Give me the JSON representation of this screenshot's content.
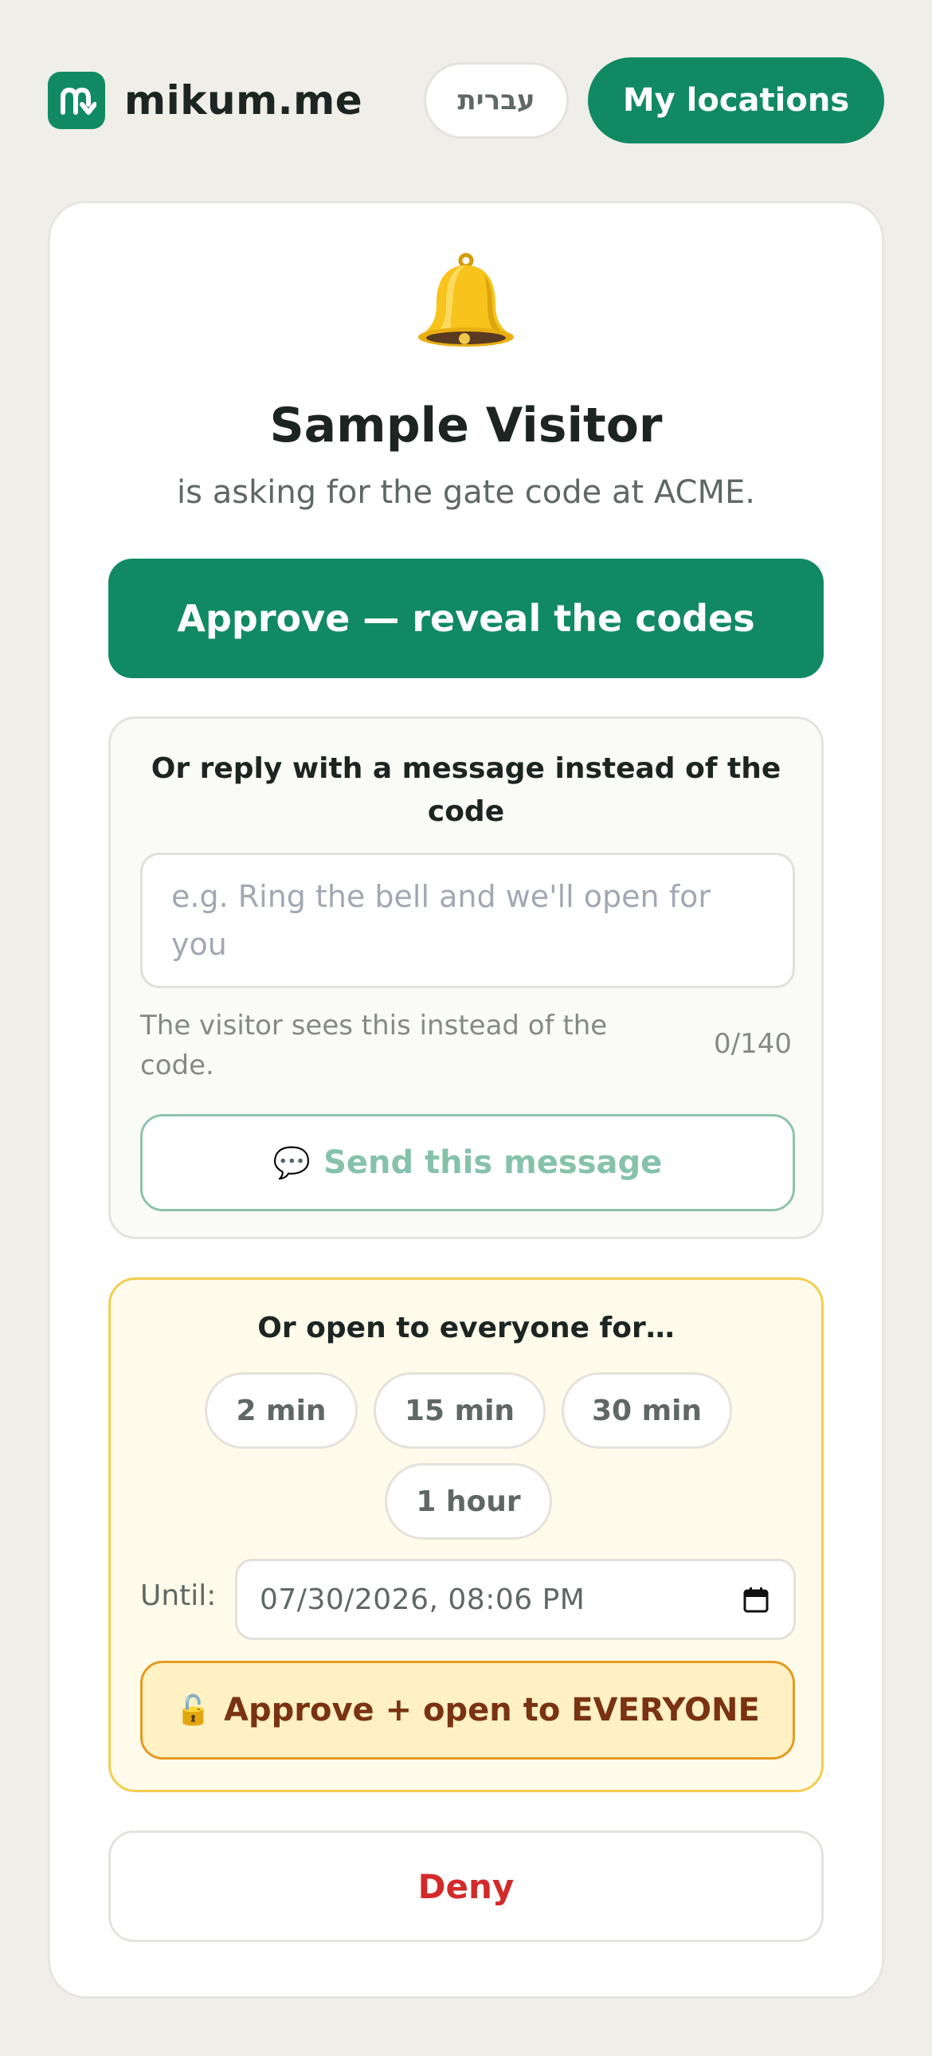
{
  "header": {
    "brand_name": "mikum.me",
    "language_label": "עברית",
    "my_locations_label": "My locations"
  },
  "request": {
    "visitor_name": "Sample Visitor",
    "subtitle": "is asking for the gate code at ACME.",
    "approve_label": "Approve — reveal the codes"
  },
  "reply": {
    "title": "Or reply with a message instead of the code",
    "input_value": "",
    "input_placeholder": "e.g. Ring the bell and we'll open for you",
    "hint": "The visitor sees this instead of the code.",
    "counter": "0/140",
    "send_label": "Send this message",
    "send_icon": "speech-bubble-icon"
  },
  "open_to_everyone": {
    "title": "Or open to everyone for…",
    "durations": [
      "2 min",
      "15 min",
      "30 min",
      "1 hour"
    ],
    "until_label": "Until:",
    "until_value": "07/30/2026, 08:06 PM",
    "approve_everyone_label": "Approve + open to EVERYONE",
    "approve_everyone_icon": "unlocked-padlock-icon"
  },
  "deny_label": "Deny",
  "colors": {
    "brand_green": "#118a63",
    "background": "#efeee9",
    "deny_red": "#d22a2a",
    "warning_border": "#f3cd4e",
    "warning_fill": "#fffbea"
  }
}
